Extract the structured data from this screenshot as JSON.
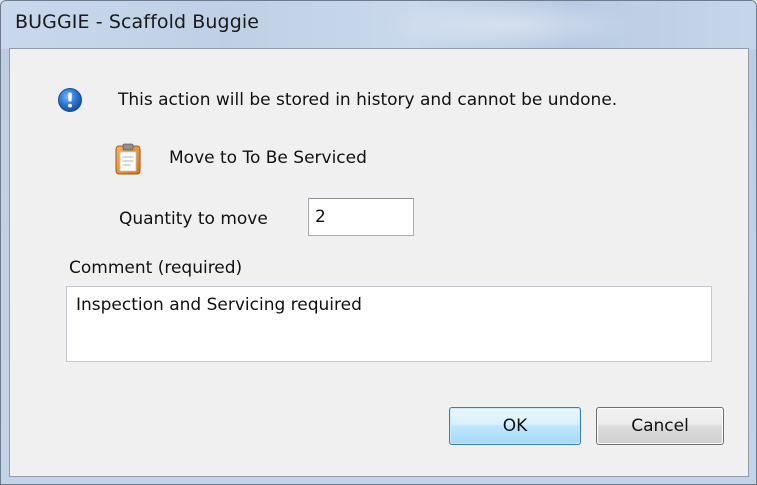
{
  "window": {
    "title": "BUGGIE - Scaffold Buggie"
  },
  "dialog": {
    "info_icon": "info-icon",
    "info_message": "This action will be stored in history and cannot be undone.",
    "action_icon": "clipboard-icon",
    "action_label": "Move to To Be Serviced",
    "quantity_label": "Quantity to move",
    "quantity_value": "2",
    "comment_label": "Comment (required)",
    "comment_value": "Inspection and Servicing required"
  },
  "buttons": {
    "ok_label": "OK",
    "cancel_label": "Cancel"
  },
  "colors": {
    "info_icon": "#1f6fd0",
    "clipboard": "#e58a1f",
    "ok_border": "#3c7fb1"
  }
}
